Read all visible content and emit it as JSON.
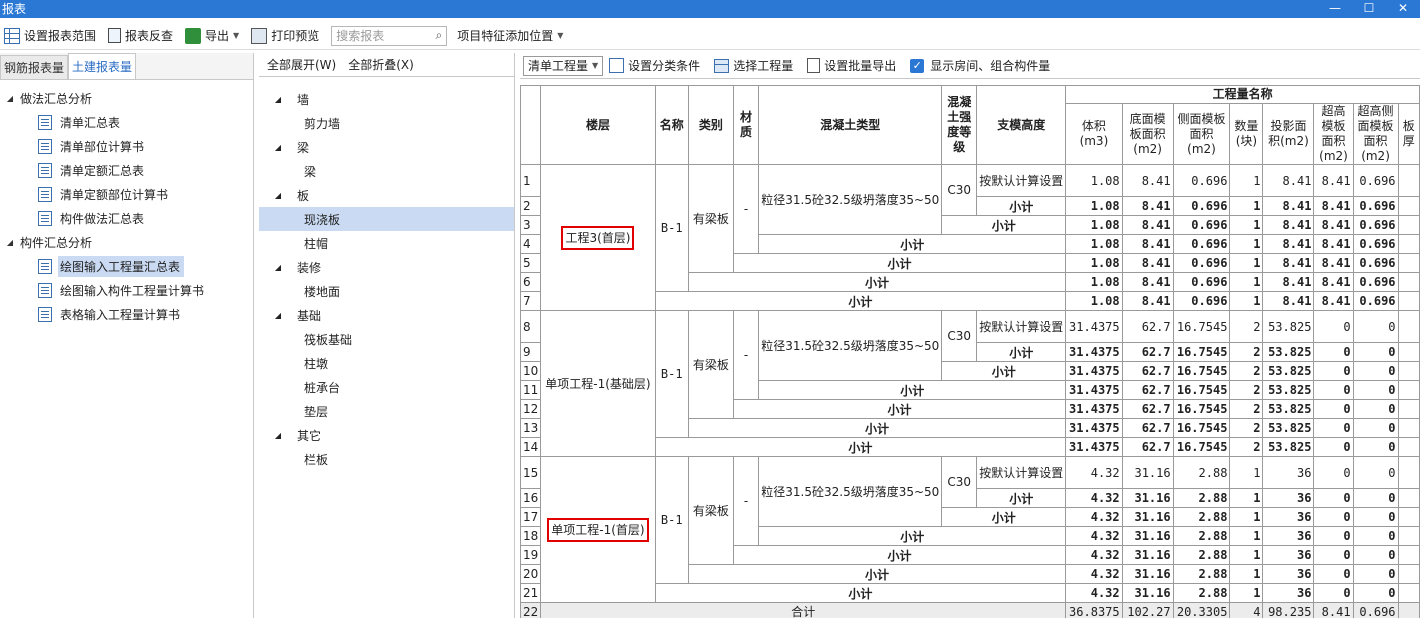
{
  "window": {
    "title": "报表",
    "controls": [
      "—",
      "☐",
      "✕"
    ]
  },
  "toolbar": {
    "set_range": "设置报表范围",
    "reverse_check": "报表反查",
    "export": "导出",
    "print_preview": "打印预览",
    "search_placeholder": "搜索报表",
    "feature_position": "项目特征添加位置"
  },
  "left": {
    "tabs": [
      "钢筋报表量",
      "土建报表量"
    ],
    "groups": [
      {
        "label": "做法汇总分析",
        "items": [
          "清单汇总表",
          "清单部位计算书",
          "清单定额汇总表",
          "清单定额部位计算书",
          "构件做法汇总表"
        ]
      },
      {
        "label": "构件汇总分析",
        "items": [
          "绘图输入工程量汇总表",
          "绘图输入构件工程量计算书",
          "表格输入工程量计算书"
        ]
      }
    ],
    "selected": "绘图输入工程量汇总表"
  },
  "middle": {
    "expand_all": "全部展开(W)",
    "collapse_all": "全部折叠(X)",
    "groups": [
      {
        "label": "墙",
        "items": [
          "剪力墙"
        ]
      },
      {
        "label": "梁",
        "items": [
          "梁"
        ]
      },
      {
        "label": "板",
        "items": [
          "现浇板",
          "柱帽"
        ]
      },
      {
        "label": "装修",
        "items": [
          "楼地面"
        ]
      },
      {
        "label": "基础",
        "items": [
          "筏板基础",
          "柱墩",
          "桩承台",
          "垫层"
        ]
      },
      {
        "label": "其它",
        "items": [
          "栏板"
        ]
      }
    ],
    "selected": "现浇板"
  },
  "right_toolbar": {
    "mode": "清单工程量",
    "set_class": "设置分类条件",
    "select_qty": "选择工程量",
    "batch_export": "设置批量导出",
    "show_rooms": "显示房间、组合构件量"
  },
  "table": {
    "headers": {
      "floor": "楼层",
      "name": "名称",
      "category": "类别",
      "material": "材质",
      "concrete_type": "混凝土类型",
      "concrete_grade": "混凝土强度等级",
      "support_height": "支模高度",
      "qty_group": "工程量名称",
      "qty_cols": [
        "体积(m3)",
        "底面模板面积(m2)",
        "侧面模板面积(m2)",
        "数量(块)",
        "投影面积(m2)",
        "超高模板面积(m2)",
        "超高侧面模板面积(m2)",
        "板厚"
      ]
    },
    "subtotal": "小计",
    "grand_total_label": "合计",
    "common": {
      "name": "B-1",
      "category": "有梁板",
      "material": "-",
      "concrete_type": "粒径31.5砼32.5级坍落度35~50",
      "concrete_grade": "C30",
      "support_height": "按默认计算设置"
    },
    "groups": [
      {
        "floor": "工程3(首层)",
        "values": [
          "1.08",
          "8.41",
          "0.696",
          "1",
          "8.41",
          "8.41",
          "0.696"
        ]
      },
      {
        "floor": "单项工程-1(基础层)",
        "values": [
          "31.4375",
          "62.7",
          "16.7545",
          "2",
          "53.825",
          "0",
          "0"
        ]
      },
      {
        "floor": "单项工程-1(首层)",
        "values": [
          "4.32",
          "31.16",
          "2.88",
          "1",
          "36",
          "0",
          "0"
        ]
      }
    ],
    "grand_total": [
      "36.8375",
      "102.27",
      "20.3305",
      "4",
      "98.235",
      "8.41",
      "0.696"
    ],
    "row_numbers": [
      "1",
      "2",
      "3",
      "4",
      "5",
      "6",
      "7",
      "8",
      "9",
      "10",
      "11",
      "12",
      "13",
      "14",
      "15",
      "16",
      "17",
      "18",
      "19",
      "20",
      "21",
      "22"
    ]
  }
}
